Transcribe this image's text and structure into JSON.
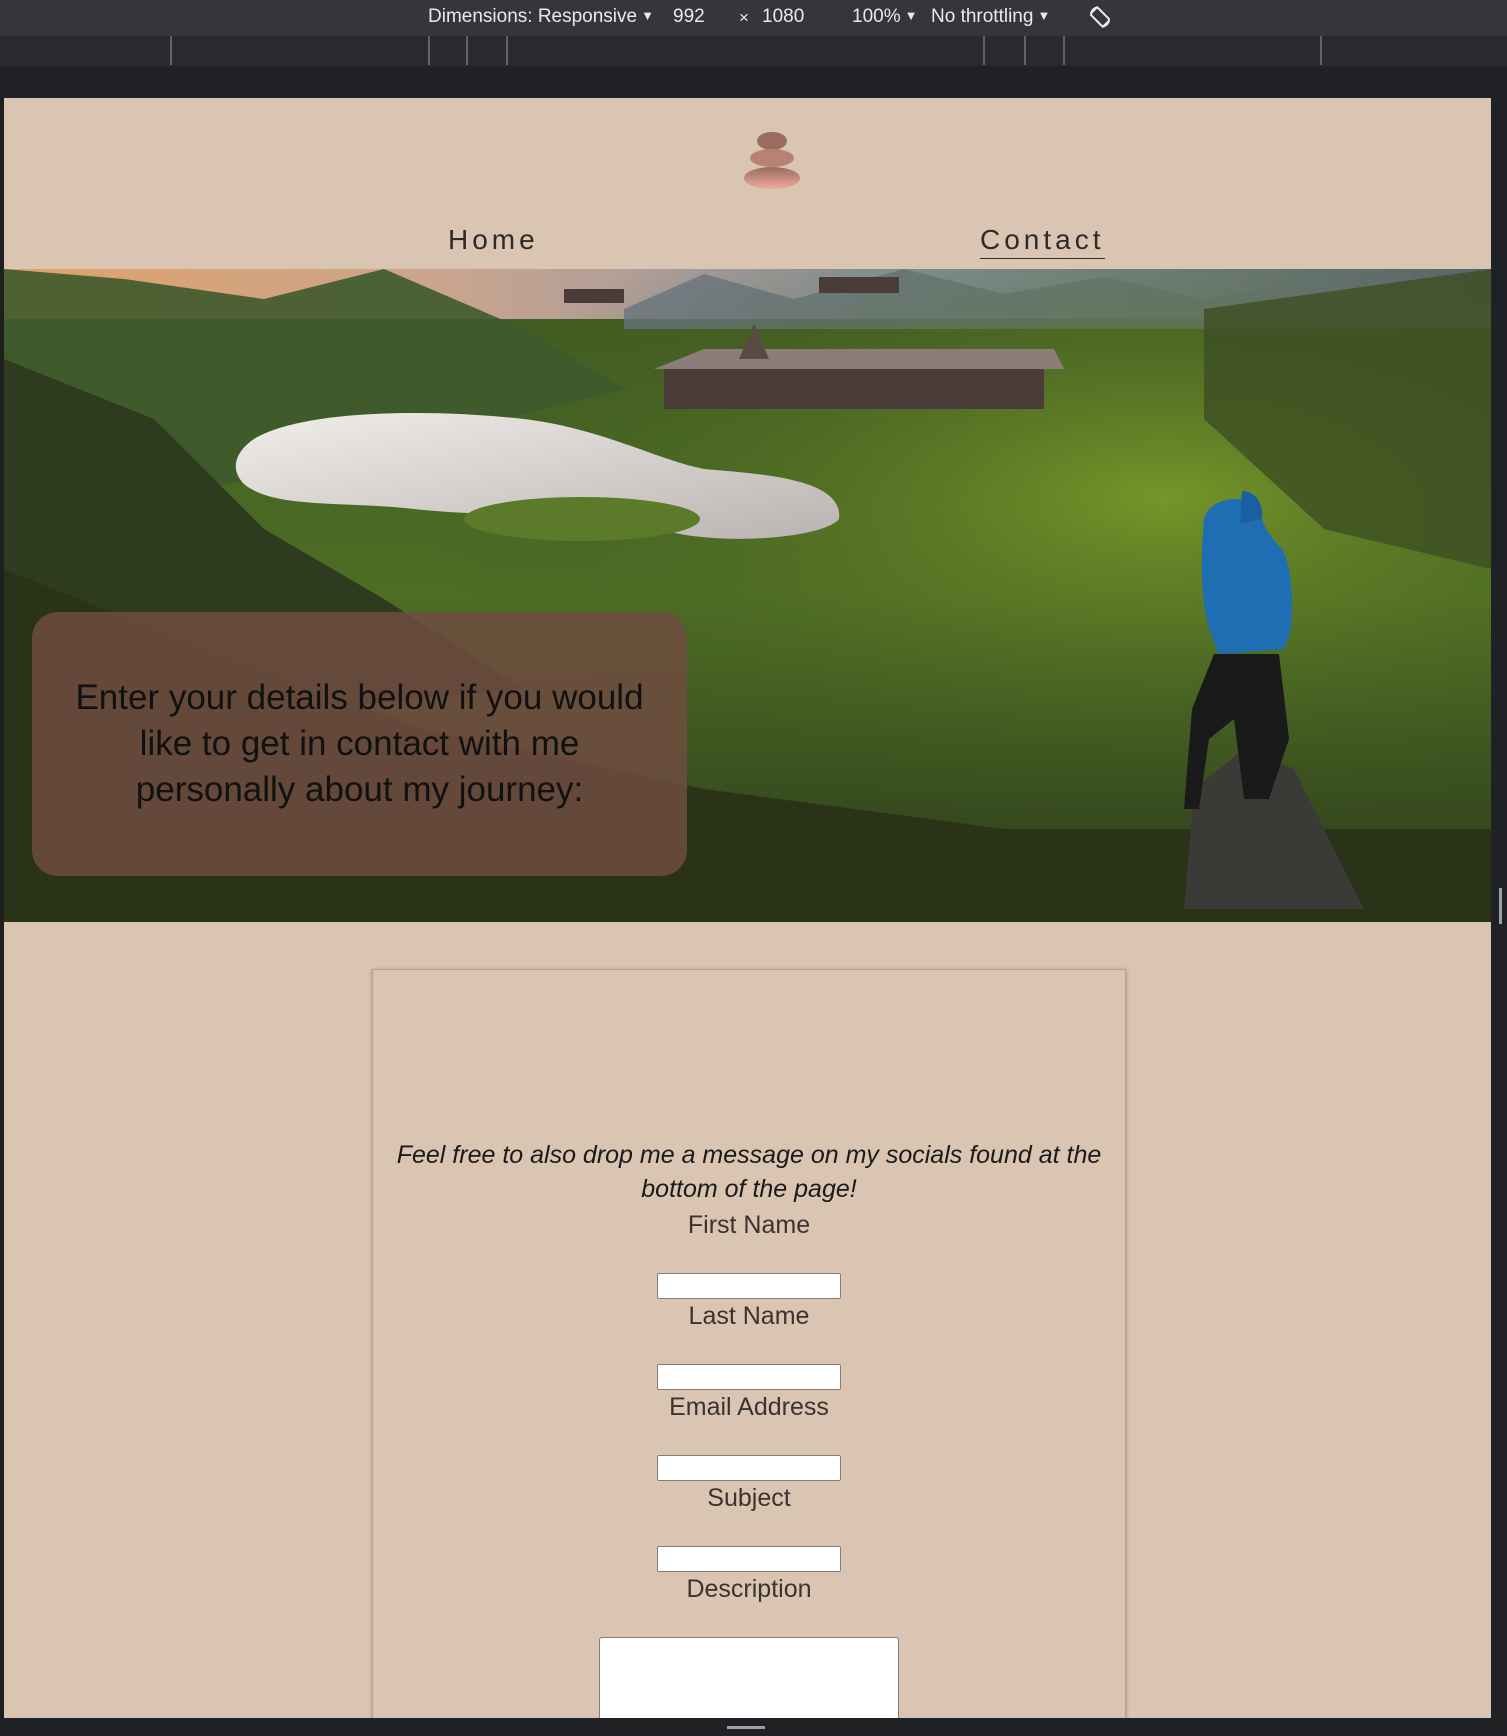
{
  "devtools": {
    "dimensions_label": "Dimensions: Responsive",
    "width": "992",
    "times": "×",
    "height": "1080",
    "zoom": "100%",
    "throttling": "No throttling",
    "caret": "▼"
  },
  "nav": {
    "home": "Home",
    "contact": "Contact"
  },
  "hero": {
    "text": "Enter your details below if you would like to get in contact with me personally about my journey:"
  },
  "form": {
    "intro": "Feel free to also drop me a message on my socials found at the bottom of the page!",
    "first_name": {
      "label": "First Name",
      "value": ""
    },
    "last_name": {
      "label": "Last Name",
      "value": ""
    },
    "email": {
      "label": "Email Address",
      "value": ""
    },
    "subject": {
      "label": "Subject",
      "value": ""
    },
    "description": {
      "label": "Description",
      "value": ""
    }
  }
}
